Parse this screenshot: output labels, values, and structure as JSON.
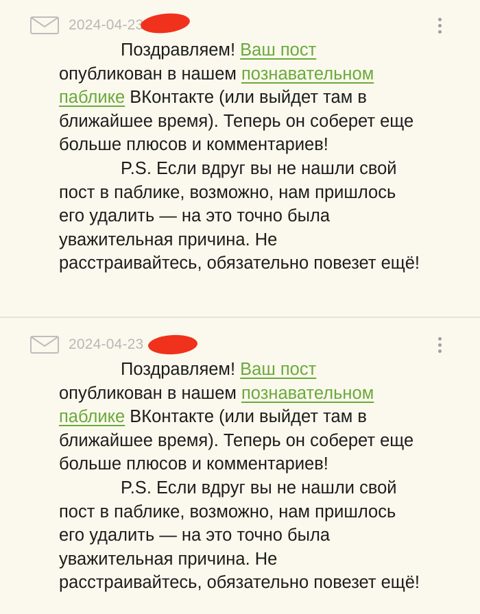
{
  "messages": [
    {
      "date": "2024-04-23",
      "body": {
        "greeting": "Поздравляем! ",
        "link_post": "Ваш пост",
        "line2_text": "опубликован в нашем ",
        "link_public_1": "познавательном",
        "link_public_2": "паблике",
        "line3_text": " ВКонтакте (или выйдет там в",
        "line4": "ближайшее время). Теперь он соберет еще",
        "line5": "больше плюсов и комментариев!",
        "line6": "P.S. Если вдруг вы не нашли свой",
        "line7": "пост в паблике, возможно, нам пришлось",
        "line8": "его удалить — на это точно была",
        "line9": "уважительная причина. Не",
        "line10": "расстраивайтесь, обязательно повезет ещё!"
      }
    },
    {
      "date": "2024-04-23",
      "body": {
        "greeting": "Поздравляем! ",
        "link_post": "Ваш пост",
        "line2_text": "опубликован в нашем ",
        "link_public_1": "познавательном",
        "link_public_2": "паблике",
        "line3_text": " ВКонтакте (или выйдет там в",
        "line4": "ближайшее время). Теперь он соберет еще",
        "line5": "больше плюсов и комментариев!",
        "line6": "P.S. Если вдруг вы не нашли свой",
        "line7": "пост в паблике, возможно, нам пришлось",
        "line8": "его удалить — на это точно была",
        "line9": "уважительная причина. Не",
        "line10": "расстраивайтесь, обязательно повезет ещё!"
      }
    }
  ],
  "icons": {
    "message": "envelope-icon",
    "menu": "more-vertical-icon"
  },
  "colors": {
    "background": "#fbf9ed",
    "link": "#6aa93b",
    "text": "#1c1c1c",
    "date": "#b8b8b8",
    "redaction": "#f0321c"
  }
}
